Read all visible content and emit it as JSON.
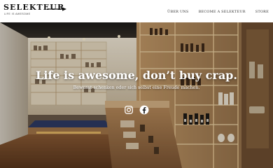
{
  "brand": {
    "name": "SELEKTEUR",
    "tagline": "LIFE IS AWESOME",
    "text_color": "#111111"
  },
  "nav": {
    "items": [
      {
        "label": "ÜBER UNS"
      },
      {
        "label": "BECOME A SELEKTEUR"
      },
      {
        "label": "STORE"
      }
    ]
  },
  "hero": {
    "title": "Life is awesome, don’t buy crap.",
    "subtitle": "Bewusst schenken oder sich selbst eine Freude machen.",
    "text_color": "#ffffff"
  },
  "social": {
    "icons": [
      "instagram-icon",
      "facebook-icon"
    ]
  }
}
